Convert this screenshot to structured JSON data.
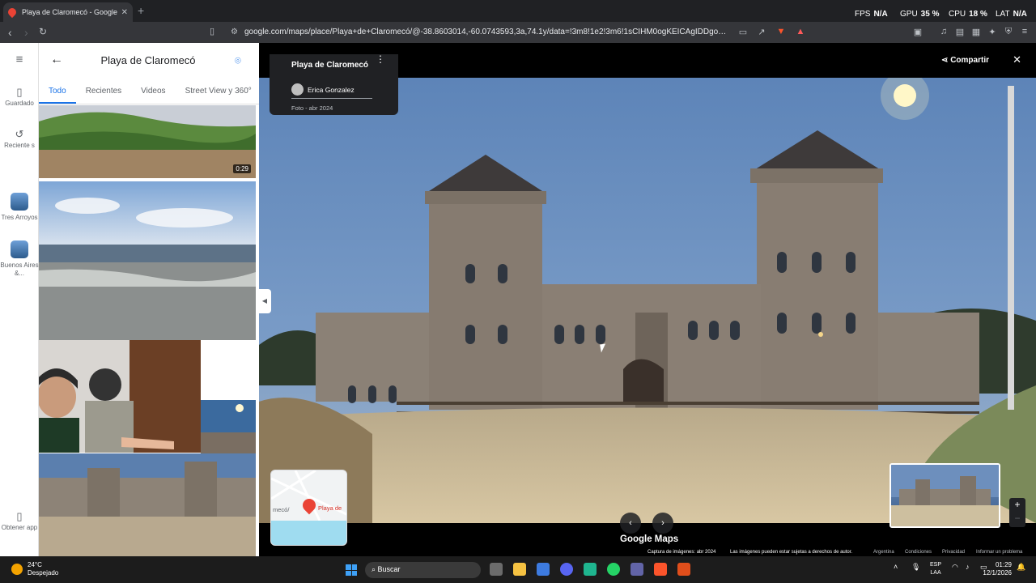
{
  "browser": {
    "tab_title": "Playa de Claromecó - Google M",
    "tab_close": "✕",
    "new_tab": "+",
    "url": "google.com/maps/place/Playa+de+Claromecó/@-38.8603014,-60.0743593,3a,74.1y/data=!3m8!1e2!3m6!1sCIHM0ogKEICAgIDDgoaUA!2e10!...",
    "perf": {
      "fps_label": "FPS",
      "fps_value": "N/A",
      "gpu_label": "GPU",
      "gpu_value": "35 %",
      "cpu_label": "CPU",
      "cpu_value": "18 %",
      "lat_label": "LAT",
      "lat_value": "N/A"
    },
    "ext_badge_brave": "5",
    "ext_badge_alert": "1"
  },
  "rail": {
    "saved": "Guardado",
    "recent": "Reciente s",
    "place1": "Tres Arroyos",
    "place2": "Buenos Aires &...",
    "get_app": "Obtener app"
  },
  "panel": {
    "title": "Playa de Claromecó",
    "tabs": [
      {
        "label": "Todo"
      },
      {
        "label": "Recientes"
      },
      {
        "label": "Videos"
      },
      {
        "label": "Street View y 360°"
      }
    ],
    "video_duration": "0:29"
  },
  "viewer": {
    "place_name": "Playa de Claromecó",
    "author": "Erica Gonzalez",
    "photo_date": "Foto - abr 2024",
    "share_label": "Compartir",
    "brand": "Google Maps",
    "capture": "Captura de imágenes: abr 2024",
    "rights": "Las imágenes pueden estar sujetas a derechos de autor.",
    "country": "Argentina",
    "terms": "Condiciones",
    "privacy": "Privacidad",
    "report": "Informar un problema",
    "minimap_label_left": "mecó/",
    "minimap_label_right": "Playa de"
  },
  "taskbar": {
    "temp": "24°C",
    "condition": "Despejado",
    "search_placeholder": "Buscar",
    "lang_top": "ESP",
    "lang_bottom": "LAA",
    "time": "01:29",
    "date": "12/1/2026",
    "discord_badge": "99+"
  },
  "colors": {
    "accent": "#1a73e8",
    "chrome_bg": "#202124",
    "pin": "#ea4335"
  }
}
